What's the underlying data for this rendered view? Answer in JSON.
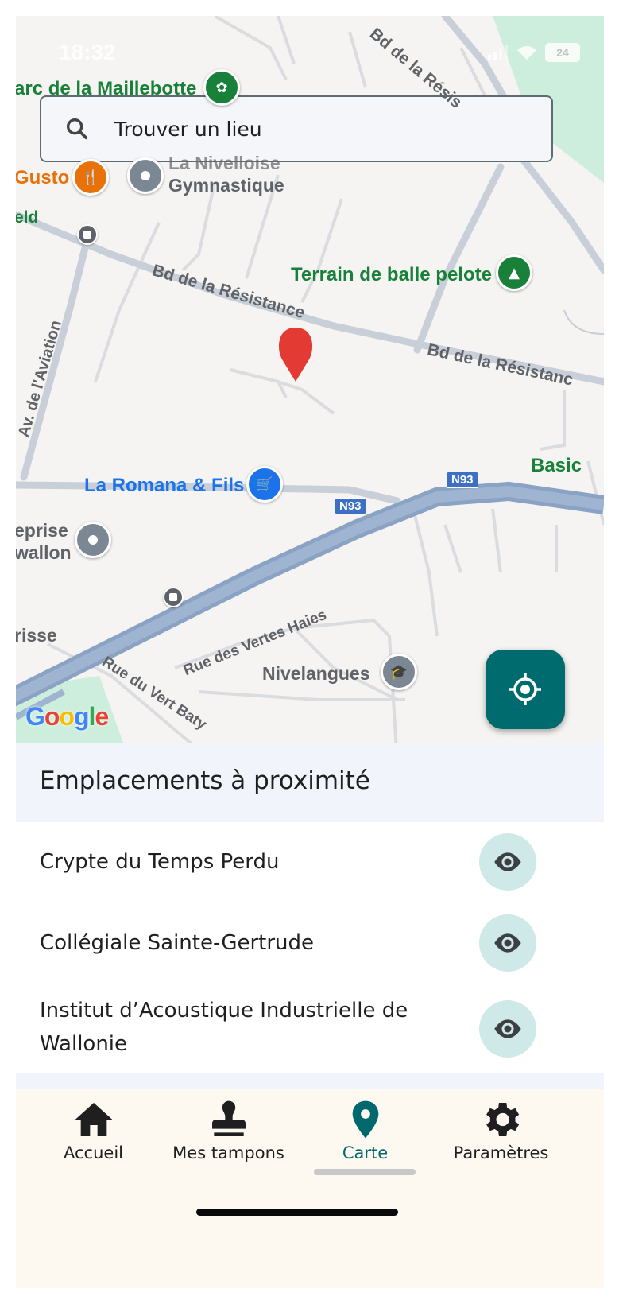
{
  "status_bar": {
    "time": "18:32",
    "battery": "24"
  },
  "search": {
    "placeholder": "Trouver un lieu"
  },
  "map": {
    "labels": {
      "parc": "arc de la Maillebotte",
      "gusto": "Gusto",
      "nivelloise_1": "La Nivelloise",
      "nivelloise_2": "Gymnastique",
      "eld": "eld",
      "terrain": "Terrain de balle pelote",
      "basic": "Basic",
      "romana": "La Romana & Fils",
      "eprise_1": "eprise",
      "eprise_2": "wallon",
      "risse": "risse",
      "nivelangues": "Nivelangues"
    },
    "roads": {
      "bd1": "Bd de la Résistance",
      "bd2": "Bd de la Résistanc",
      "bd_top": "Bd de la Résis",
      "aviation": "Av. de l'Aviation",
      "vertes_haies": "Rue des Vertes Haies",
      "vert_baty": "Rue du Vert Baty"
    },
    "shields": {
      "n93_a": "N93",
      "n93_b": "N93"
    },
    "attribution": "Google"
  },
  "nearby": {
    "title": "Emplacements à proximité",
    "places": [
      {
        "name": "Crypte du Temps Perdu"
      },
      {
        "name": "Collégiale Sainte-Gertrude"
      },
      {
        "name": "Institut d’Acoustique Industrielle de Wallonie"
      }
    ]
  },
  "nav": {
    "items": [
      {
        "label": "Accueil",
        "icon": "home-icon"
      },
      {
        "label": "Mes tampons",
        "icon": "stamp-icon"
      },
      {
        "label": "Carte",
        "icon": "map-pin-icon"
      },
      {
        "label": "Paramètres",
        "icon": "gear-icon"
      }
    ],
    "active": "Carte"
  },
  "colors": {
    "accent": "#006b6e",
    "eye_bg": "#cfe8e8",
    "nav_bg": "#fdf8f0",
    "header_bg": "#f1f5fb"
  }
}
